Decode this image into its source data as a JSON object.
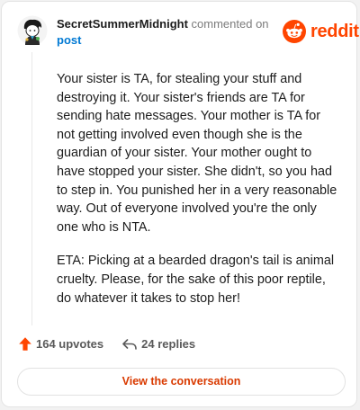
{
  "header": {
    "username": "SecretSummerMidnight",
    "action_text": "commented on",
    "post_link": "post"
  },
  "brand": {
    "wordmark": "reddit",
    "icon": "reddit-snoo-icon",
    "color": "#ff4500"
  },
  "comment": {
    "paragraphs": [
      "Your sister is TA, for stealing your stuff and destroying it. Your sister's friends are TA for sending hate messages. Your mother is TA for not getting involved even though she is the guardian of your sister. Your mother ought to have stopped your sister. She didn't, so you had to step in. You punished her in a very reasonable way. Out of everyone involved you're the only one who is NTA.",
      "ETA: Picking at a bearded dragon's tail is animal cruelty. Please, for the sake of this poor reptile, do whatever it takes to stop her!"
    ]
  },
  "footer": {
    "upvotes": "164 upvotes",
    "upvote_icon": "upvote-arrow-icon",
    "upvote_color": "#ff4500",
    "replies": "24 replies",
    "reply_icon": "reply-arrow-icon"
  },
  "actions": {
    "view_conversation": "View the conversation",
    "button_text_color": "#d93a00"
  }
}
